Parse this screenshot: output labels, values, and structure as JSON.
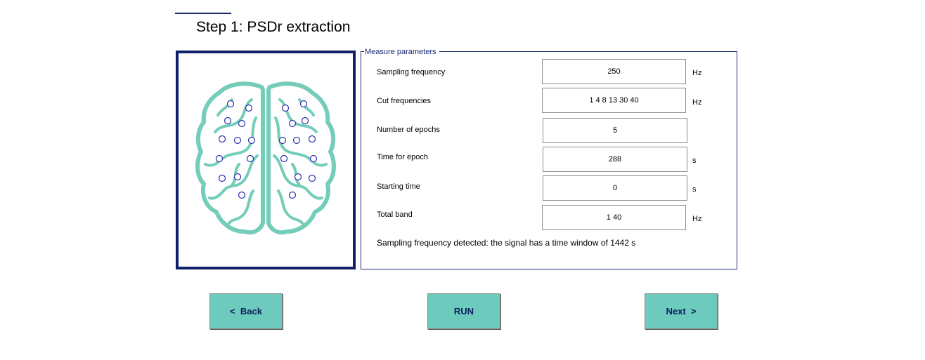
{
  "page": {
    "title": "Step 1: PSDr extraction"
  },
  "params": {
    "legend": "Measure parameters",
    "rows": [
      {
        "label": "Sampling frequency",
        "value": "250",
        "unit": "Hz"
      },
      {
        "label": "Cut frequencies",
        "value": "1 4 8 13 30 40",
        "unit": "Hz"
      },
      {
        "label": "Number of epochs",
        "value": "5",
        "unit": ""
      },
      {
        "label": "Time for epoch",
        "value": "288",
        "unit": "s"
      },
      {
        "label": "Starting time",
        "value": "0",
        "unit": "s"
      },
      {
        "label": "Total band",
        "value": "1 40",
        "unit": "Hz"
      }
    ],
    "status": "Sampling frequency detected: the signal has a time window of 1442 s"
  },
  "buttons": {
    "back": "<  Back",
    "run": "RUN",
    "next": "Next  >"
  },
  "colors": {
    "accent": "#6ccbbc",
    "navy": "#101e6b",
    "brain": "#74cdb9",
    "electrode": "#2b2fae"
  },
  "icons": {
    "brain": "brain-eeg-electrodes-icon"
  }
}
